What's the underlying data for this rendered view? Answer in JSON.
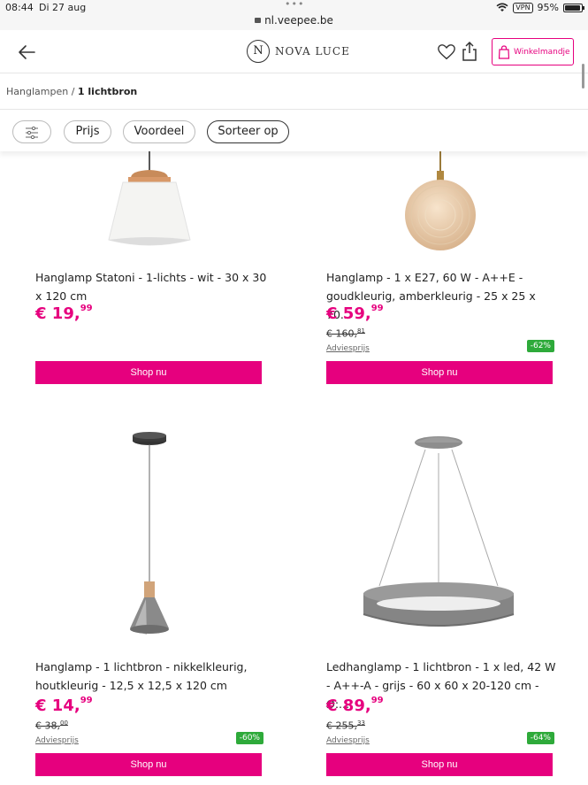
{
  "status_bar": {
    "time": "08:44",
    "date": "Di 27 aug",
    "dots": "•••",
    "url": "nl.veepee.be",
    "vpn": "VPN",
    "battery": "95%"
  },
  "header": {
    "logo_letter": "N",
    "brand": "NOVA LUCE",
    "cart_label": "Winkelmandje"
  },
  "breadcrumb": {
    "parent": "Hanglampen",
    "separator": "/",
    "current": "1 lichtbron"
  },
  "filters": {
    "prijs": "Prijs",
    "voordeel": "Voordeel",
    "sorteer": "Sorteer op"
  },
  "products": [
    {
      "title": "Hanglamp Statoni - 1-lichts - wit - 30 x 30 x 120 cm",
      "price_int": "€ 19,",
      "price_dec": "99",
      "button": "Shop nu",
      "image": "white-pendant-lamp"
    },
    {
      "title": "Hanglamp - 1 x E27, 60 W - A++E - goudkleurig, amberkleurig - 25 x 25 x 70...",
      "price_int": "€ 59,",
      "price_dec": "99",
      "old_int": "€ 160,",
      "old_dec": "81",
      "advies": "Adviesprijs",
      "discount": "-62%",
      "button": "Shop nu",
      "image": "amber-globe-lamp"
    },
    {
      "title": "Hanglamp - 1 lichtbron - nikkelkleurig, houtkleurig - 12,5 x 12,5 x 120 cm",
      "price_int": "€ 14,",
      "price_dec": "99",
      "old_int": "€ 38,",
      "old_dec": "00",
      "advies": "Adviesprijs",
      "discount": "-60%",
      "button": "Shop nu",
      "image": "nickel-cone-pendant"
    },
    {
      "title": "Ledhanglamp - 1 lichtbron - 1 x led, 42 W - A++-A - grijs - 60 x 60 x 20-120 cm - Ø:...",
      "price_int": "€ 89,",
      "price_dec": "99",
      "old_int": "€ 255,",
      "old_dec": "33",
      "advies": "Adviesprijs",
      "discount": "-64%",
      "button": "Shop nu",
      "image": "grey-led-ring-lamp"
    }
  ],
  "colors": {
    "accent": "#e6007e",
    "discount": "#2eaa3a"
  }
}
